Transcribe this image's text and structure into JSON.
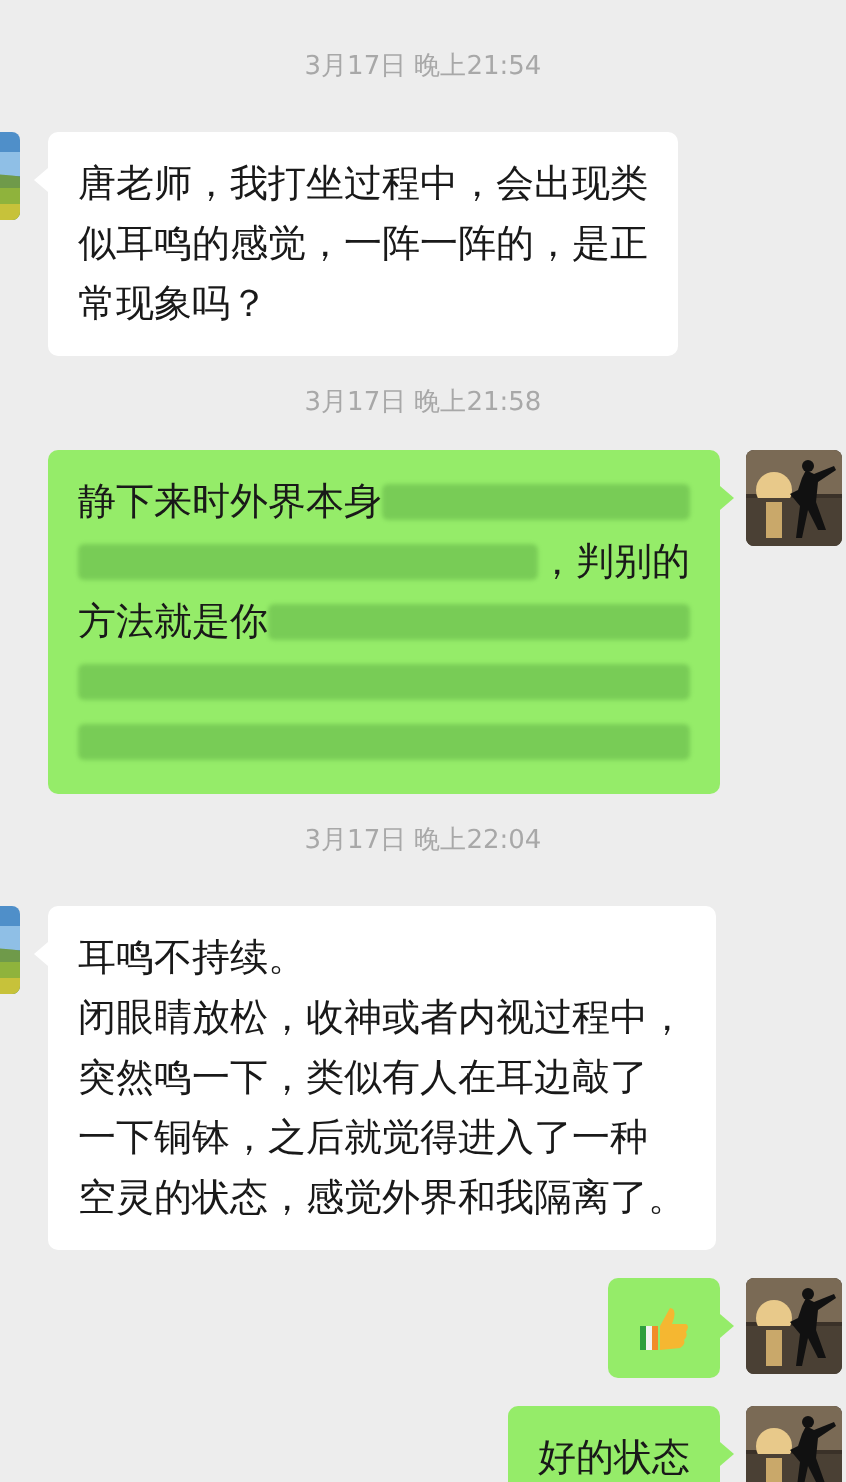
{
  "messages": [
    {
      "kind": "time",
      "text": "3月17日 晚上21:54"
    },
    {
      "kind": "text",
      "outgoing": false,
      "lines": [
        "唐老师，我打坐过程中，会出现类",
        "似耳鸣的感觉，一阵一阵的，是正",
        "常现象吗？"
      ]
    },
    {
      "kind": "time",
      "text": "3月17日 晚上21:58"
    },
    {
      "kind": "redacted",
      "outgoing": true,
      "lines": [
        {
          "segments": [
            {
              "kind": "text",
              "text": "静下来时外界本身"
            },
            {
              "kind": "blur"
            }
          ]
        },
        {
          "segments": [
            {
              "kind": "blur"
            },
            {
              "kind": "text",
              "text": "，判别的"
            }
          ]
        },
        {
          "segments": [
            {
              "kind": "text",
              "text": "方法就是你"
            },
            {
              "kind": "blur"
            }
          ]
        },
        {
          "segments": [
            {
              "kind": "blur"
            }
          ]
        },
        {
          "segments": [
            {
              "kind": "blur"
            }
          ]
        }
      ]
    },
    {
      "kind": "time",
      "text": "3月17日 晚上22:04"
    },
    {
      "kind": "text",
      "outgoing": false,
      "lines": [
        "耳鸣不持续。",
        "闭眼睛放松，收神或者内视过程中，",
        "突然鸣一下，类似有人在耳边敲了",
        "一下铜钵，之后就觉得进入了一种",
        "空灵的状态，感觉外界和我隔离了。"
      ]
    },
    {
      "kind": "thumbs_up",
      "outgoing": true
    },
    {
      "kind": "text",
      "outgoing": true,
      "lines": [
        "好的状态"
      ]
    }
  ]
}
